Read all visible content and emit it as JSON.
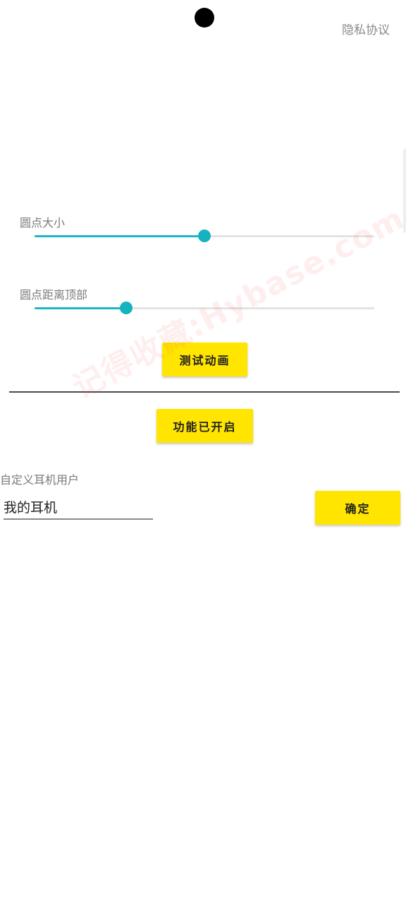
{
  "header": {
    "privacy_link": "隐私协议"
  },
  "sliders": [
    {
      "label": "圆点大小",
      "value": 0.5,
      "color": "#15b3be"
    },
    {
      "label": "圆点距离顶部",
      "value": 0.27,
      "color": "#15b3be"
    }
  ],
  "buttons": {
    "test_animation": "测试动画",
    "feature_status": "功能已开启",
    "confirm": "确定",
    "color": "#ffe500"
  },
  "custom_user": {
    "label": "自定义耳机用户",
    "value": "我的耳机"
  },
  "watermark": "记得收藏:Hybase.com"
}
